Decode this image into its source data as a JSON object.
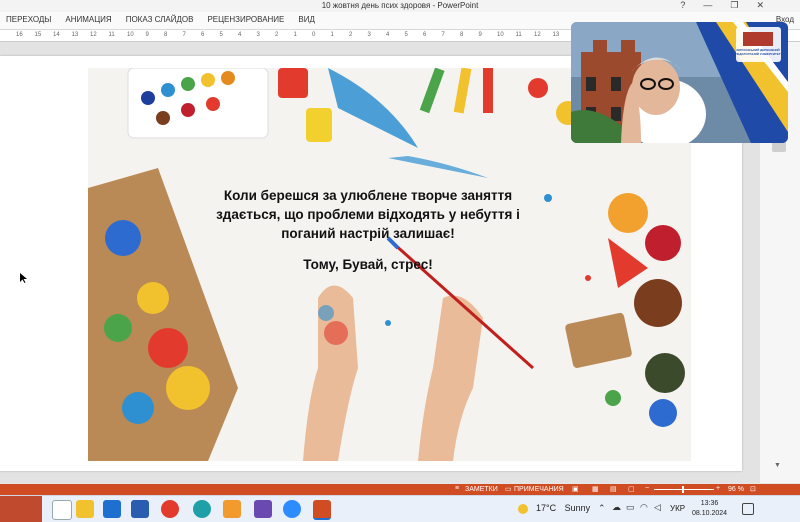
{
  "window": {
    "title": "10 жовтня день псих здоровя - PowerPoint",
    "help_icon": "?",
    "minimize_icon": "—",
    "restore_icon": "❐",
    "close_icon": "✕"
  },
  "ribbon": {
    "tabs": [
      "ПЕРЕХОДЫ",
      "АНИМАЦИЯ",
      "ПОКАЗ СЛАЙДОВ",
      "РЕЦЕНЗИРОВАНИЕ",
      "ВИД"
    ],
    "account_label": "Вход"
  },
  "ruler": {
    "ticks": [
      "16",
      "15",
      "14",
      "13",
      "12",
      "11",
      "10",
      "9",
      "8",
      "7",
      "6",
      "5",
      "4",
      "3",
      "2",
      "1",
      "0",
      "1",
      "2",
      "3",
      "4",
      "5",
      "6",
      "7",
      "8",
      "9",
      "10",
      "11",
      "12",
      "13"
    ]
  },
  "slide": {
    "text_line1": "Коли берешся за улюблене творче заняття",
    "text_line2": "здається, що проблеми відходять у небуття і",
    "text_line3": "поганий настрій залишає!",
    "text_line4": "Тому, Бувай, стрес!"
  },
  "webcam": {
    "logo_text": "ХЕРСОНСЬКИЙ ДЕРЖАВНИЙ ПЕДАГОГІЧНИЙ УНІВЕРСИТЕТ"
  },
  "statusbar": {
    "notes_label": "ЗАМЕТКИ",
    "comments_label": "ПРИМЕЧАНИЯ",
    "zoom_label": "96 %"
  },
  "taskbar": {
    "temperature": "17°C",
    "weather": "Sunny",
    "language": "УКР",
    "time": "13:36",
    "date": "08.10.2024"
  },
  "colors": {
    "accent": "#d04c22",
    "taskbar": "#eaf0fa"
  }
}
